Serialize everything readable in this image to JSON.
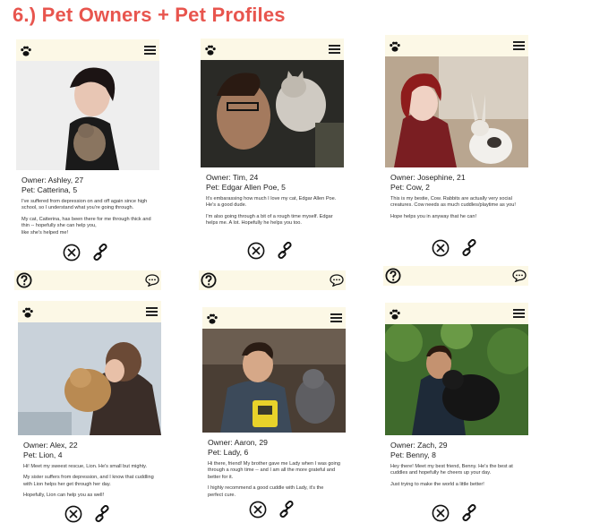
{
  "page": {
    "title": "6.) Pet Owners + Pet Profiles"
  },
  "colors": {
    "title": "#e8554e",
    "bar": "#fcf8e6",
    "icon": "#111111"
  },
  "profiles": [
    {
      "owner": "Owner: Ashley, 27",
      "pet": "Pet: Catterina, 5",
      "bio": [
        "I've suffered from depression on and off again since high school, so I understand what you're going through.",
        "My cat, Catterina, has been there for me through thick and thin -- hopefully she can help you,",
        "like she's helped me!"
      ]
    },
    {
      "owner": "Owner: Tim, 24",
      "pet": "Pet: Edgar Allen Poe, 5",
      "bio": [
        "It's embarassing how much I love my cat, Edgar Allen Poe. He's a good dude.",
        "I'm also going through a bit of a rough time myself. Edgar helps me. A lot. Hopefully he helps you too."
      ]
    },
    {
      "owner": "Owner: Josephine, 21",
      "pet": "Pet: Cow, 2",
      "bio": [
        "This is my bestie, Cow. Rabbits are actually very social creatures. Cow needs as much cuddles/playtime as you!",
        "Hope helps you in anyway that he can!"
      ]
    },
    {
      "owner": "Owner: Alex, 22",
      "pet": "Pet: Lion, 4",
      "bio": [
        "Hi! Meet my sweest rescue, Lion. He's small but mighty.",
        "My sister suffers from depression, and I know that cuddling with Lion helps her get through her day.",
        "Hopefully, Lion can help you as well!"
      ]
    },
    {
      "owner": "Owner: Aaron, 29",
      "pet": "Pet: Lady, 6",
      "bio": [
        "Hi there, friend! My brother gave me Lady when I was going through a rough time -- and I am all the more grateful and better for it.",
        "I highly recommend a good cuddle with Lady, it's the perfect cure."
      ]
    },
    {
      "owner": "Owner: Zach, 29",
      "pet": "Pet: Benny, 8",
      "bio": [
        "Hey there! Meet my best friend, Benny. He's the best at cuddles and hopefully he cheers up your day.",
        "Just trying to make the world a little better!"
      ]
    }
  ],
  "icons": {
    "paw": "paw-icon",
    "menu": "hamburger-menu-icon",
    "reject": "close-circle-icon",
    "connect": "link-icon",
    "help": "question-mark-icon",
    "chat": "chat-bubble-icon"
  }
}
